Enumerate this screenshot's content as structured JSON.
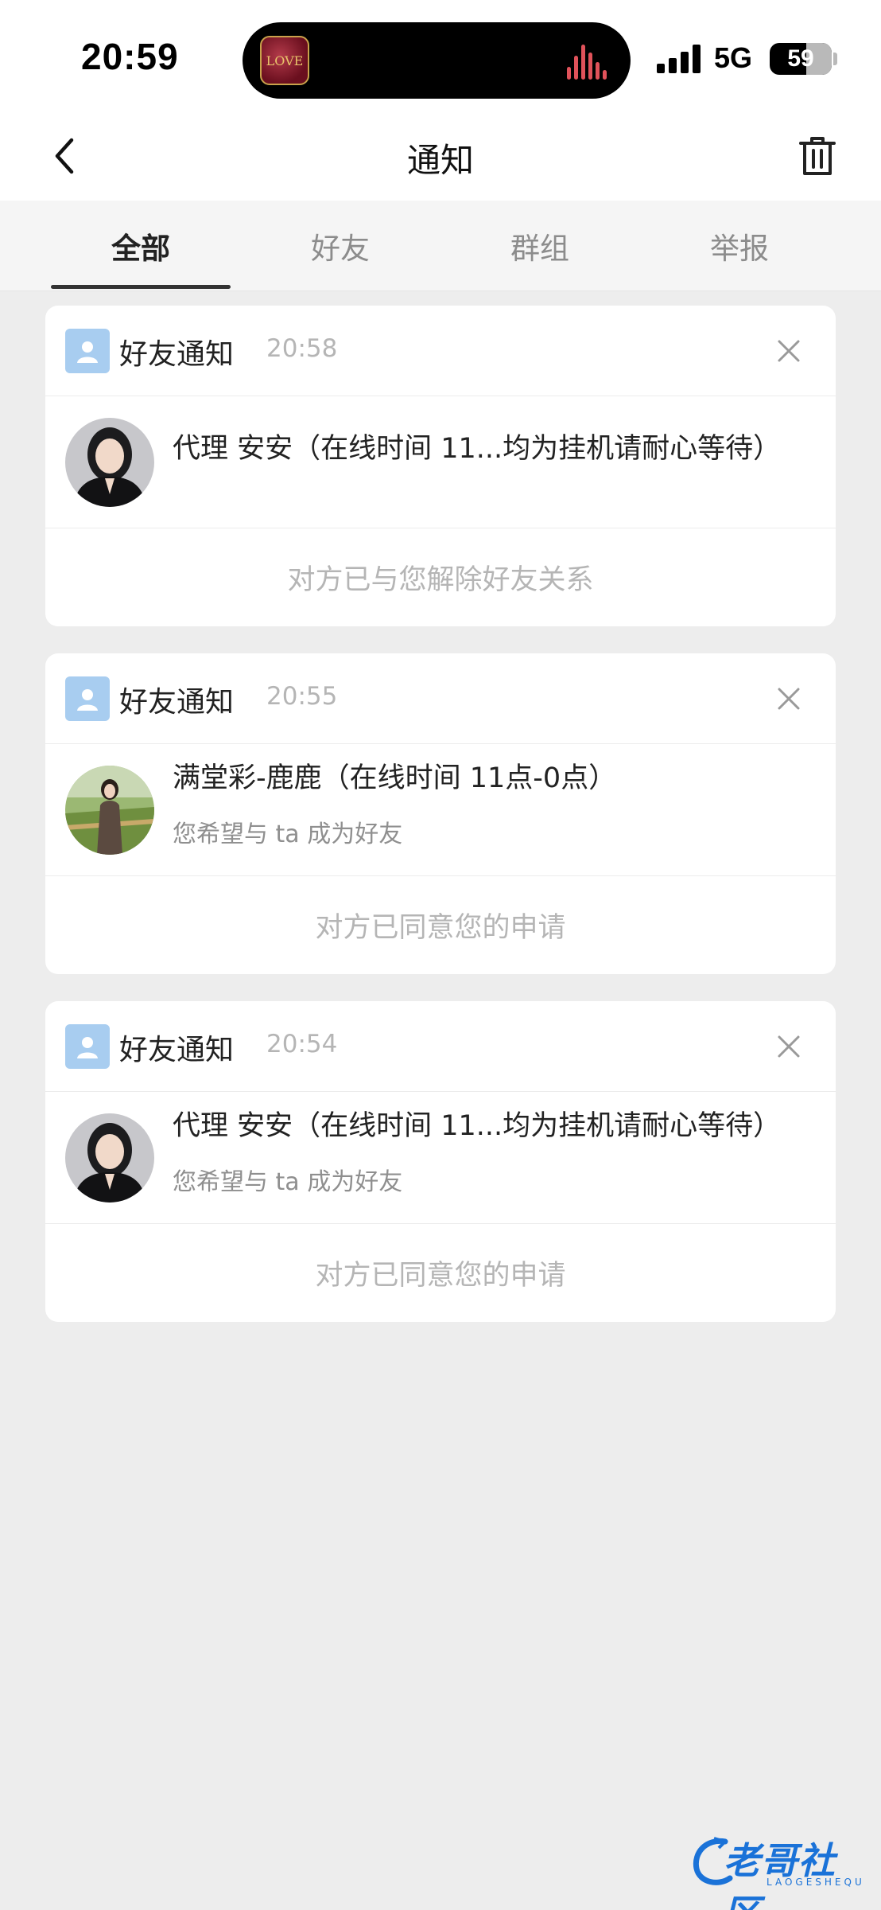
{
  "status_bar": {
    "time": "20:59",
    "island_app_label": "LOVE",
    "network": "5G",
    "battery": "59",
    "battery_level": 0.59
  },
  "header": {
    "title": "通知",
    "back_icon": "chevron-left-icon",
    "delete_icon": "trash-icon"
  },
  "tabs": [
    {
      "label": "全部",
      "active": true
    },
    {
      "label": "好友",
      "active": false
    },
    {
      "label": "群组",
      "active": false
    },
    {
      "label": "举报",
      "active": false
    }
  ],
  "notifications": [
    {
      "type_label": "好友通知",
      "time": "20:58",
      "name": "代理 安安（在线时间 11...均为挂机请耐心等待）",
      "subtitle": "",
      "status": "对方已与您解除好友关系"
    },
    {
      "type_label": "好友通知",
      "time": "20:55",
      "name": "满堂彩-鹿鹿（在线时间 11点-0点）",
      "subtitle": "您希望与 ta 成为好友",
      "status": "对方已同意您的申请"
    },
    {
      "type_label": "好友通知",
      "time": "20:54",
      "name": "代理 安安（在线时间 11...均为挂机请耐心等待）",
      "subtitle": "您希望与 ta 成为好友",
      "status": "对方已同意您的申请"
    }
  ],
  "watermark": {
    "title": "老哥社区",
    "subtitle": "LAOGESHEQU"
  },
  "colors": {
    "background": "#ededed",
    "card": "#ffffff",
    "muted_text": "#b5b5b5",
    "type_icon": "#a8cdf0",
    "watermark": "#1a72d8"
  }
}
